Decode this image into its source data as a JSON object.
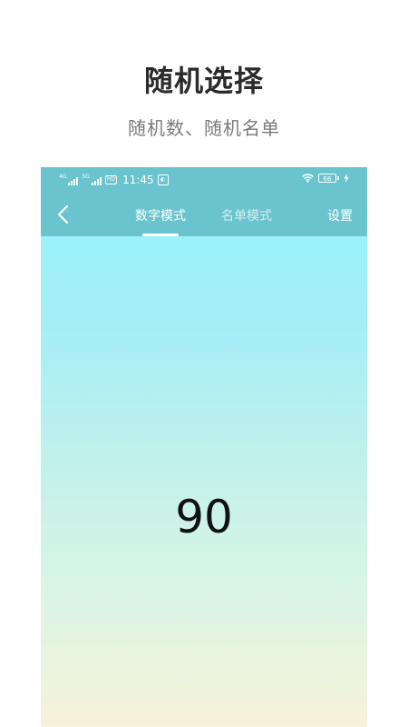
{
  "promo": {
    "title": "随机选择",
    "subtitle": "随机数、随机名单"
  },
  "status_bar": {
    "network1": "4G",
    "network2": "5G",
    "hd_badge": "HD",
    "time": "11:45",
    "battery": "66"
  },
  "nav": {
    "tabs": [
      {
        "label": "数字模式",
        "active": true
      },
      {
        "label": "名单模式",
        "active": false
      }
    ],
    "settings_label": "设置"
  },
  "main": {
    "result": "90"
  },
  "colors": {
    "header_bg": "#6ac4ce",
    "gradient_top": "#94f3fd",
    "gradient_bottom": "#f7f2d8"
  }
}
